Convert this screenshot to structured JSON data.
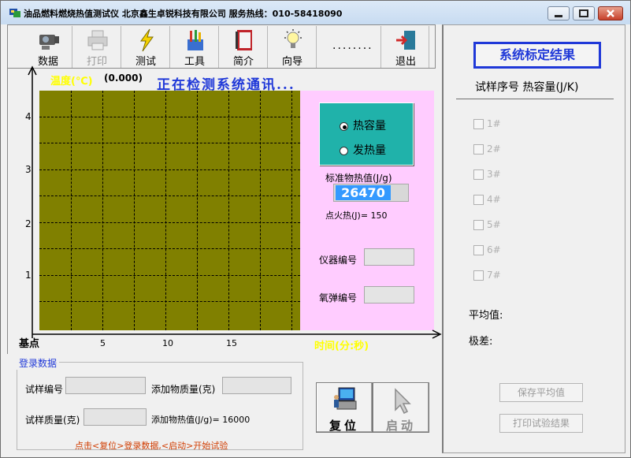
{
  "window": {
    "title": "油品燃料燃烧热值测试仪   北京鑫生卓锐科技有限公司   服务热线：010-58418090"
  },
  "toolbar": {
    "items": [
      {
        "label": "数据",
        "icon": "camera-icon",
        "enabled": true
      },
      {
        "label": "打印",
        "icon": "printer-icon",
        "enabled": false
      },
      {
        "label": "测试",
        "icon": "lightning-icon",
        "enabled": true
      },
      {
        "label": "工具",
        "icon": "tools-icon",
        "enabled": true
      },
      {
        "label": "简介",
        "icon": "notebook-icon",
        "enabled": true
      },
      {
        "label": "向导",
        "icon": "lightbulb-icon",
        "enabled": true
      },
      {
        "label": "退出",
        "icon": "exit-door-icon",
        "enabled": true
      }
    ],
    "dots": "........"
  },
  "chart": {
    "y_label": "温度(℃)",
    "y_value": "(0.000)",
    "status": "正在检测系统通讯...",
    "y_ticks": [
      "4",
      "3",
      "2",
      "1"
    ],
    "x_ticks": [
      "5",
      "10",
      "15"
    ],
    "origin_label": "基点",
    "x_label": "时间(分:秒)"
  },
  "chart_data": {
    "type": "line",
    "series": [],
    "xlabel": "时间(分:秒)",
    "ylabel": "温度(℃)",
    "x_ticks": [
      5,
      10,
      15
    ],
    "y_ticks": [
      1,
      2,
      3,
      4
    ],
    "grid": true
  },
  "calibration": {
    "radio_heat_capacity": "热容量",
    "radio_heat_release": "发热量",
    "selected": "热容量",
    "std_heat_label": "标准物热值(J/g)",
    "std_heat_value": "26470",
    "ignition_label": "点火热(J)= 150",
    "instrument_label": "仪器编号",
    "instrument_value": "",
    "bomb_label": "氧弹编号",
    "bomb_value": ""
  },
  "login": {
    "group_title": "登录数据",
    "sample_no_label": "试样编号",
    "sample_no_value": "",
    "additive_mass_label": "添加物质量(克)",
    "additive_mass_value": "",
    "sample_mass_label": "试样质量(克)",
    "sample_mass_value": "",
    "additive_heat_label": "添加物热值(J/g)= 16000",
    "hint": "点击<复位>登录数据,<启动>开始试验"
  },
  "actions": {
    "reset_label": "复位",
    "start_label": "启动"
  },
  "results": {
    "title": "系统标定结果",
    "header": "试样序号  热容量(J/K)",
    "rows": [
      "1#",
      "2#",
      "3#",
      "4#",
      "5#",
      "6#",
      "7#"
    ],
    "average_label": "平均值:",
    "range_label": "极差:",
    "save_avg_label": "保存平均值",
    "print_result_label": "打印试验结果"
  }
}
